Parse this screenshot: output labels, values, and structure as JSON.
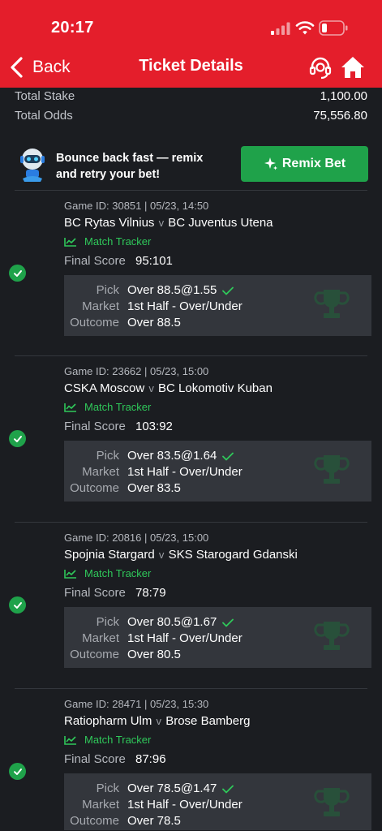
{
  "status_bar": {
    "time": "20:17"
  },
  "header": {
    "back_label": "Back",
    "title": "Ticket Details"
  },
  "totals": [
    {
      "label": "Total Stake",
      "value": "1,100.00"
    },
    {
      "label": "Total Odds",
      "value": "75,556.80"
    }
  ],
  "promo": {
    "line1": "Bounce back fast — remix",
    "line2": "and retry your bet!",
    "button_label": "Remix Bet"
  },
  "labels": {
    "match_tracker": "Match Tracker",
    "final_score": "Final Score",
    "pick": "Pick",
    "market": "Market",
    "outcome": "Outcome",
    "vs": "v"
  },
  "events": [
    {
      "game_id": "Game ID: 30851 | 05/23, 14:50",
      "home": "BC Rytas Vilnius",
      "away": "BC Juventus Utena",
      "score": "95:101",
      "pick": "Over 88.5@1.55",
      "market": "1st Half - Over/Under",
      "outcome": "Over 88.5"
    },
    {
      "game_id": "Game ID: 23662 | 05/23, 15:00",
      "home": "CSKA Moscow",
      "away": "BC Lokomotiv Kuban",
      "score": "103:92",
      "pick": "Over 83.5@1.64",
      "market": "1st Half - Over/Under",
      "outcome": "Over 83.5"
    },
    {
      "game_id": "Game ID: 20816 | 05/23, 15:00",
      "home": "Spojnia Stargard",
      "away": "SKS Starogard Gdanski",
      "score": "78:79",
      "pick": "Over 80.5@1.67",
      "market": "1st Half - Over/Under",
      "outcome": "Over 80.5"
    },
    {
      "game_id": "Game ID: 28471 | 05/23, 15:30",
      "home": "Ratiopharm Ulm",
      "away": "Brose Bamberg",
      "score": "87:96",
      "pick": "Over 78.5@1.47",
      "market": "1st Half - Over/Under",
      "outcome": "Over 78.5"
    }
  ],
  "colors": {
    "header_red": "#e41e2b",
    "accent_green": "#1fa24a",
    "tracker_green": "#2fc85a",
    "background": "#1b1d21",
    "box": "#33363c"
  }
}
